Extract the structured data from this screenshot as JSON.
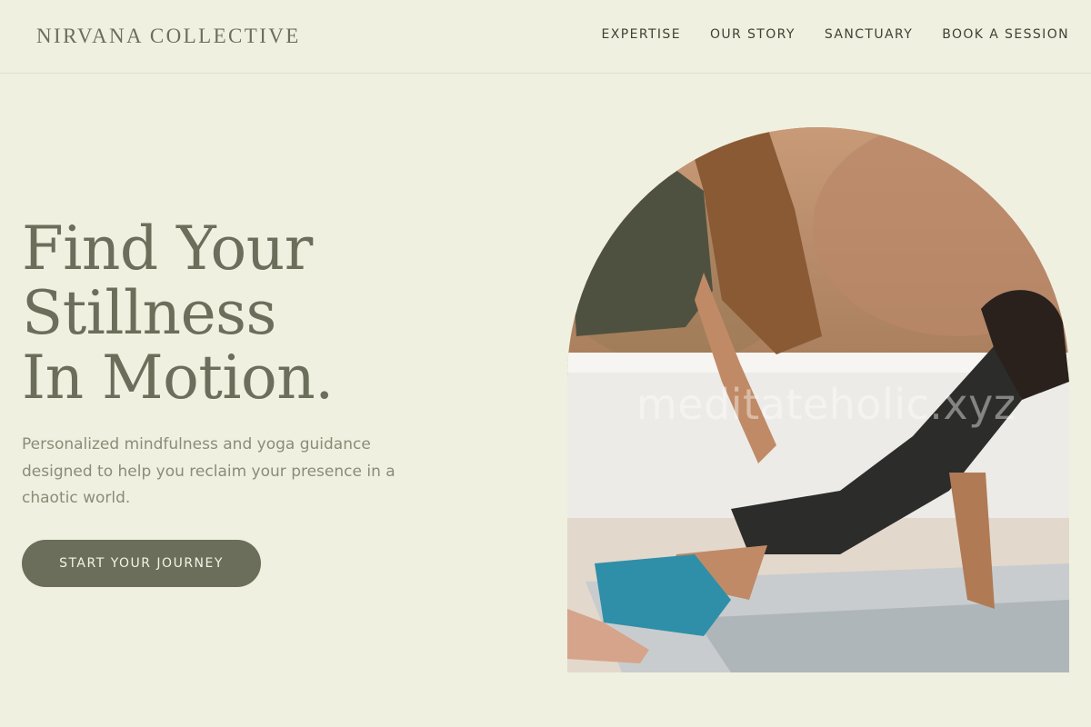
{
  "header": {
    "brand": "NIRVANA COLLECTIVE",
    "nav": [
      {
        "label": "EXPERTISE"
      },
      {
        "label": "OUR STORY"
      },
      {
        "label": "SANCTUARY"
      },
      {
        "label": "BOOK A SESSION"
      }
    ]
  },
  "hero": {
    "title_lines": [
      "Find Your",
      "Stillness",
      "In Motion."
    ],
    "subtitle": "Personalized mindfulness and yoga guidance designed to help you reclaim your presence in a chaotic world.",
    "cta_label": "START YOUR JOURNEY"
  },
  "image": {
    "subject": "yoga-instructor-adjusting-student-photo",
    "watermark": "meditateholic.xyz"
  },
  "colors": {
    "background": "#f0f0e0",
    "accent": "#6b6e5a",
    "nav_text": "#3f4135",
    "body_text": "#8a8c78"
  }
}
